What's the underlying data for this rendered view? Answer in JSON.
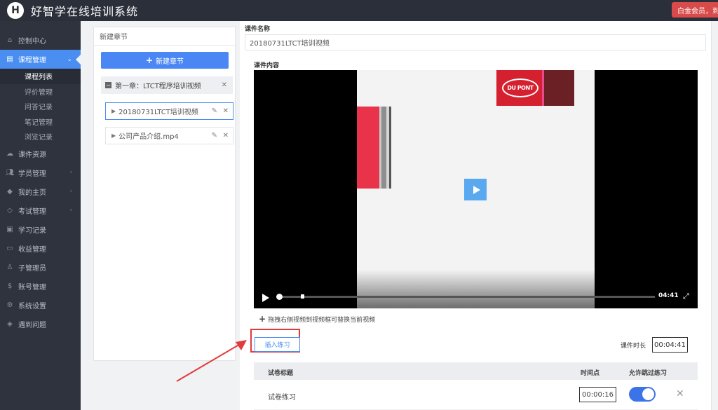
{
  "header": {
    "logo_letter": "H",
    "title": "好智学在线培训系统",
    "member_badge": "白金会员，到期"
  },
  "sidebar": {
    "items": [
      {
        "label": "控制中心",
        "icon": "home-icon"
      },
      {
        "label": "课程管理",
        "icon": "book-icon",
        "active": true
      },
      {
        "label": "课件资源",
        "icon": "cloud-icon"
      },
      {
        "label": "学员管理",
        "icon": "users-icon"
      },
      {
        "label": "我的主页",
        "icon": "graduation-icon"
      },
      {
        "label": "考试管理",
        "icon": "tag-icon"
      },
      {
        "label": "学习记录",
        "icon": "record-icon"
      },
      {
        "label": "收益管理",
        "icon": "card-icon"
      },
      {
        "label": "子管理员",
        "icon": "user-lock-icon"
      },
      {
        "label": "账号管理",
        "icon": "dollar-icon"
      },
      {
        "label": "系统设置",
        "icon": "gear-icon"
      },
      {
        "label": "遇到问题",
        "icon": "question-icon"
      }
    ],
    "sub_items": [
      {
        "label": "课程列表",
        "active": true
      },
      {
        "label": "评价管理"
      },
      {
        "label": "问答记录"
      },
      {
        "label": "笔记管理"
      },
      {
        "label": "浏览记录"
      }
    ]
  },
  "chapter_panel": {
    "heading": "新建章节",
    "new_chapter_button": "新建章节",
    "chapter_title": "第一章：LTCT程序培训视频",
    "lessons": [
      {
        "label": "20180731LTCT培训视频",
        "active": true
      },
      {
        "label": "公司产品介绍.mp4"
      }
    ]
  },
  "main": {
    "course_name_label": "课件名称",
    "course_name_value": "20180731LTCT培训视频",
    "content_label": "课件内容",
    "video_time": "04:41",
    "video_brand_text": "DU PONT",
    "drag_hint": "拖拽右侧视频到视频框可替换当前视频",
    "insert_exercise_button": "插入练习",
    "duration_label": "课件时长",
    "duration_value": "00:04:41",
    "exercise_table": {
      "headers": [
        "试卷标题",
        "时间点",
        "允许跳过练习"
      ],
      "rows": [
        {
          "title": "试卷练习",
          "time": "00:00:16",
          "allow_skip": true
        }
      ]
    }
  },
  "colors": {
    "primary": "#4a86f4",
    "sidebar_bg": "#2f333e",
    "header_bg": "#2b2f3a",
    "badge_red": "#d94a4a",
    "highlight_red": "#e23b3b"
  }
}
